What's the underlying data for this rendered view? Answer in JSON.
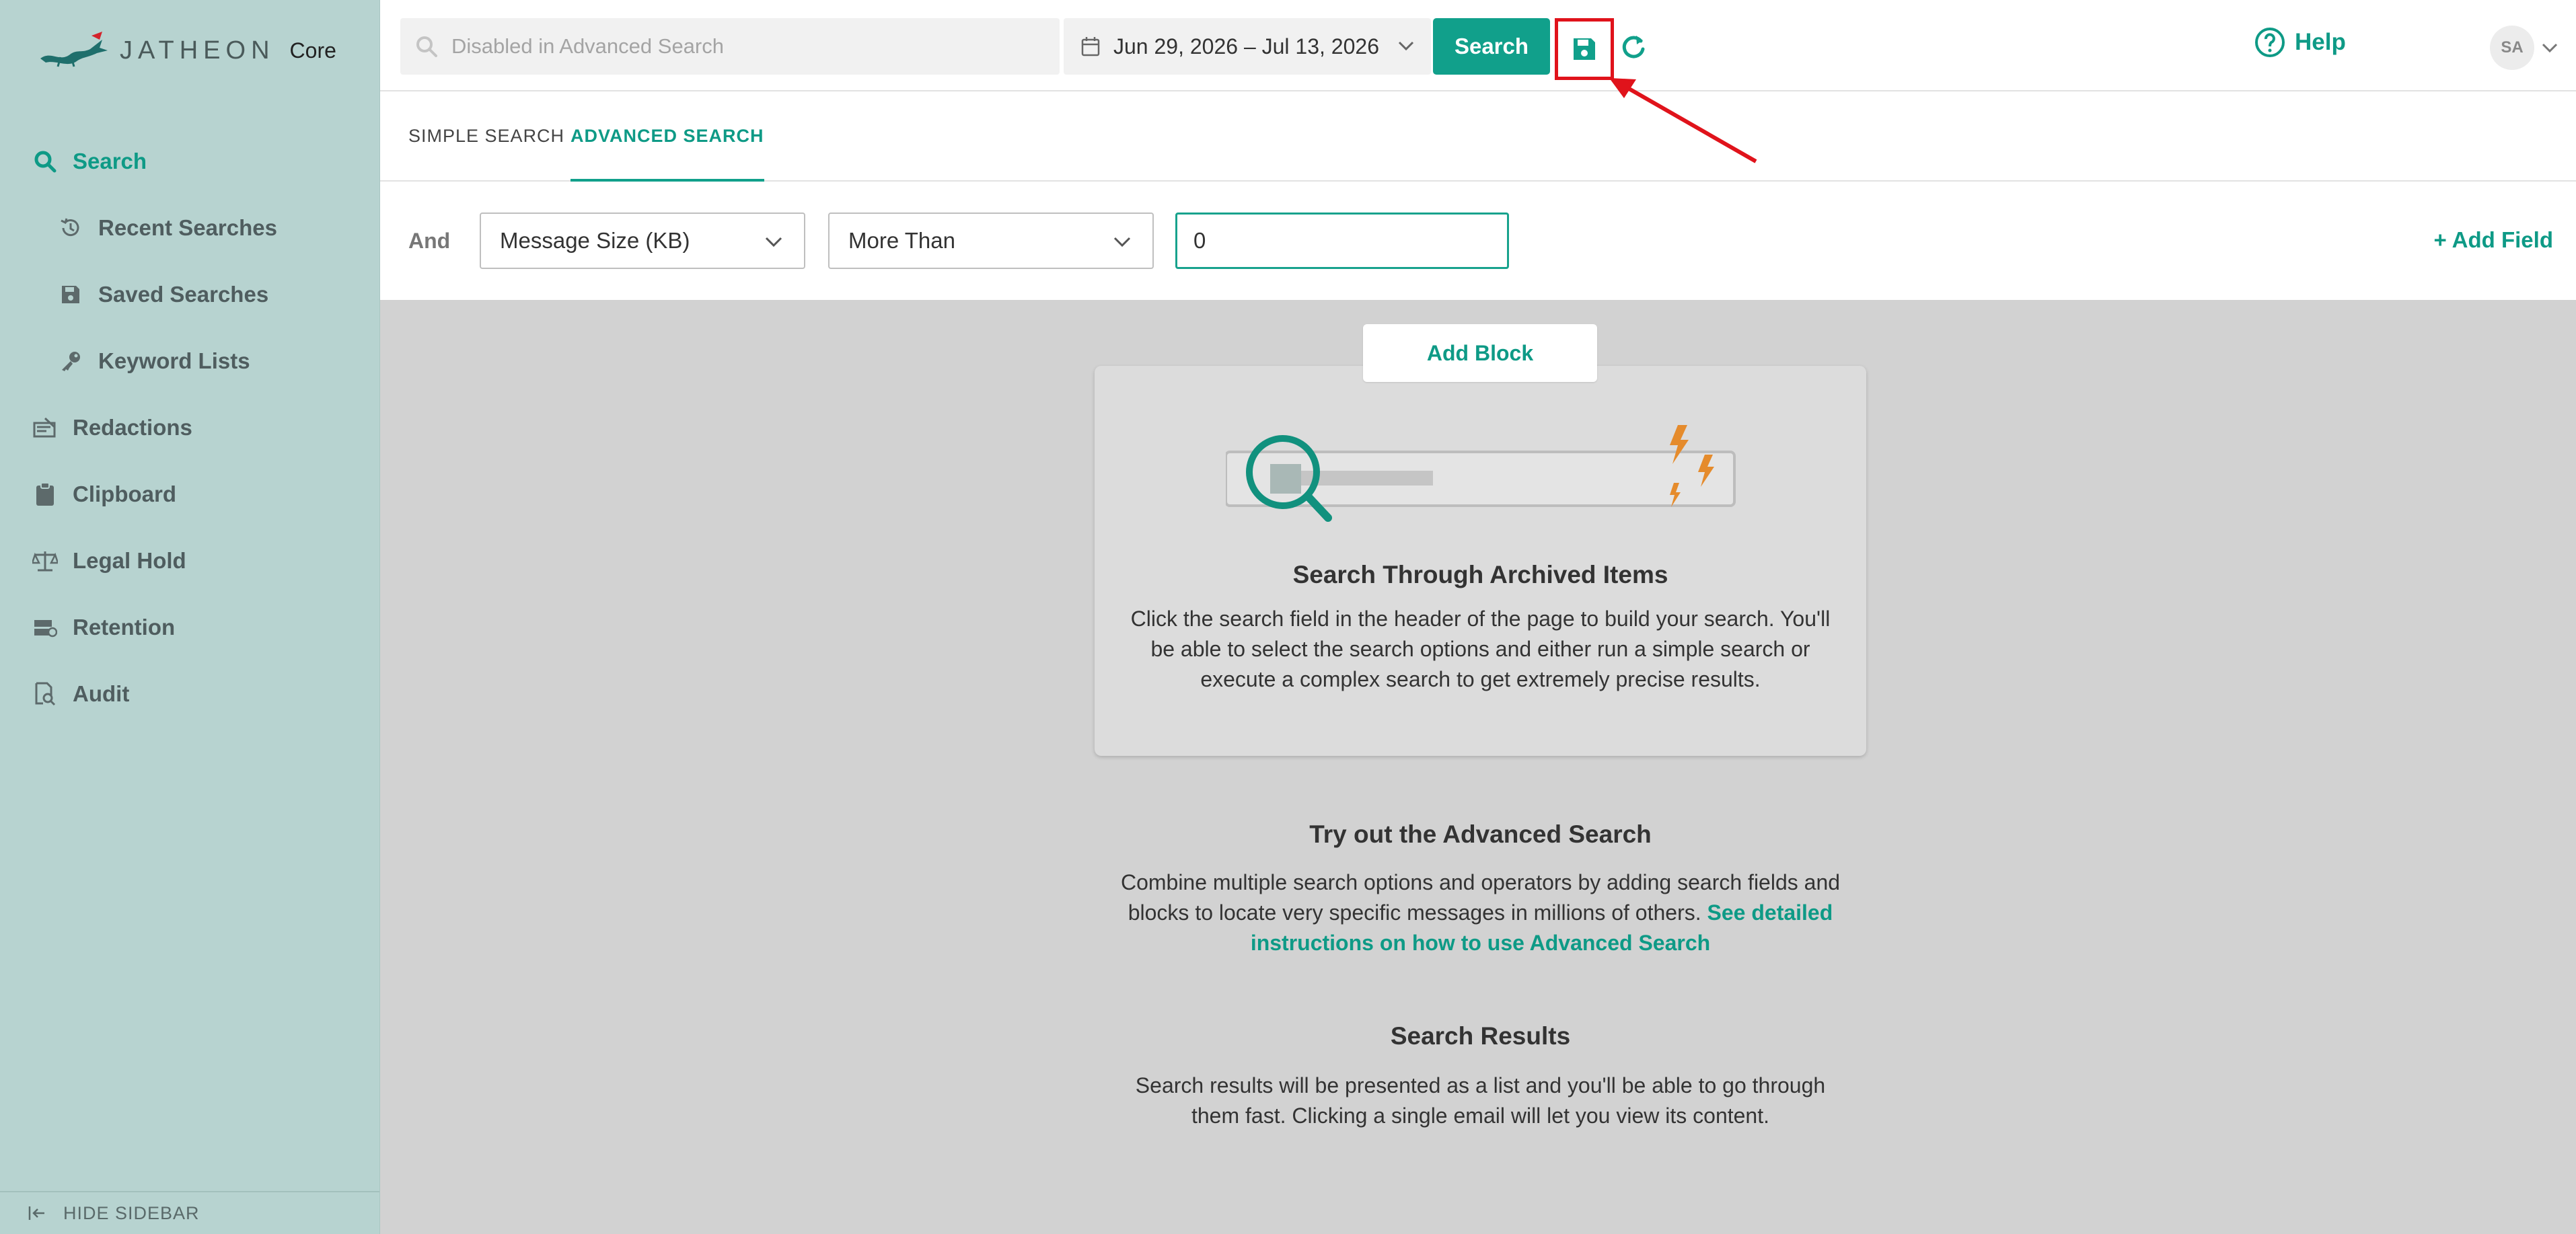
{
  "app": {
    "logo_text": "JATHEON",
    "logo_edition": "Core"
  },
  "sidebar": {
    "items": [
      {
        "label": "Search",
        "icon": "search-icon",
        "active": true
      },
      {
        "label": "Recent Searches",
        "icon": "history-icon"
      },
      {
        "label": "Saved Searches",
        "icon": "save-icon"
      },
      {
        "label": "Keyword Lists",
        "icon": "key-icon"
      },
      {
        "label": "Redactions",
        "icon": "redaction-icon"
      },
      {
        "label": "Clipboard",
        "icon": "clipboard-icon"
      },
      {
        "label": "Legal Hold",
        "icon": "scale-icon"
      },
      {
        "label": "Retention",
        "icon": "retention-icon"
      },
      {
        "label": "Audit",
        "icon": "audit-icon"
      }
    ],
    "footer_label": "HIDE SIDEBAR"
  },
  "header": {
    "search_placeholder": "Disabled in Advanced Search",
    "date_range": "Jun 29, 2026 – Jul 13, 2026",
    "search_button": "Search",
    "help_label": "Help",
    "avatar_initials": "SA"
  },
  "tabs": [
    {
      "label": "SIMPLE SEARCH",
      "active": false
    },
    {
      "label": "ADVANCED SEARCH",
      "active": true
    }
  ],
  "filter": {
    "operator": "And",
    "field": "Message Size (KB)",
    "condition": "More Than",
    "value": "0",
    "add_field": "+ Add Field"
  },
  "main": {
    "add_block": "Add Block",
    "card_title": "Search Through Archived Items",
    "card_desc": "Click the search field in the header of the page to build your search. You'll be able to select the search options and either run a simple search or execute a complex search to get extremely precise results.",
    "advanced_title": "Try out the Advanced Search",
    "advanced_desc": "Combine multiple search options and operators by adding search fields and blocks to locate very specific messages in millions of others.",
    "advanced_link": "See detailed instructions on how to use Advanced Search",
    "results_title": "Search Results",
    "results_desc": "Search results will be presented as a list and you'll be able to go through them fast. Clicking a single email will let you view its content."
  },
  "colors": {
    "accent": "#11a08b",
    "sidebar_bg": "#b7d3d0",
    "annotation_red": "#e0131b"
  }
}
